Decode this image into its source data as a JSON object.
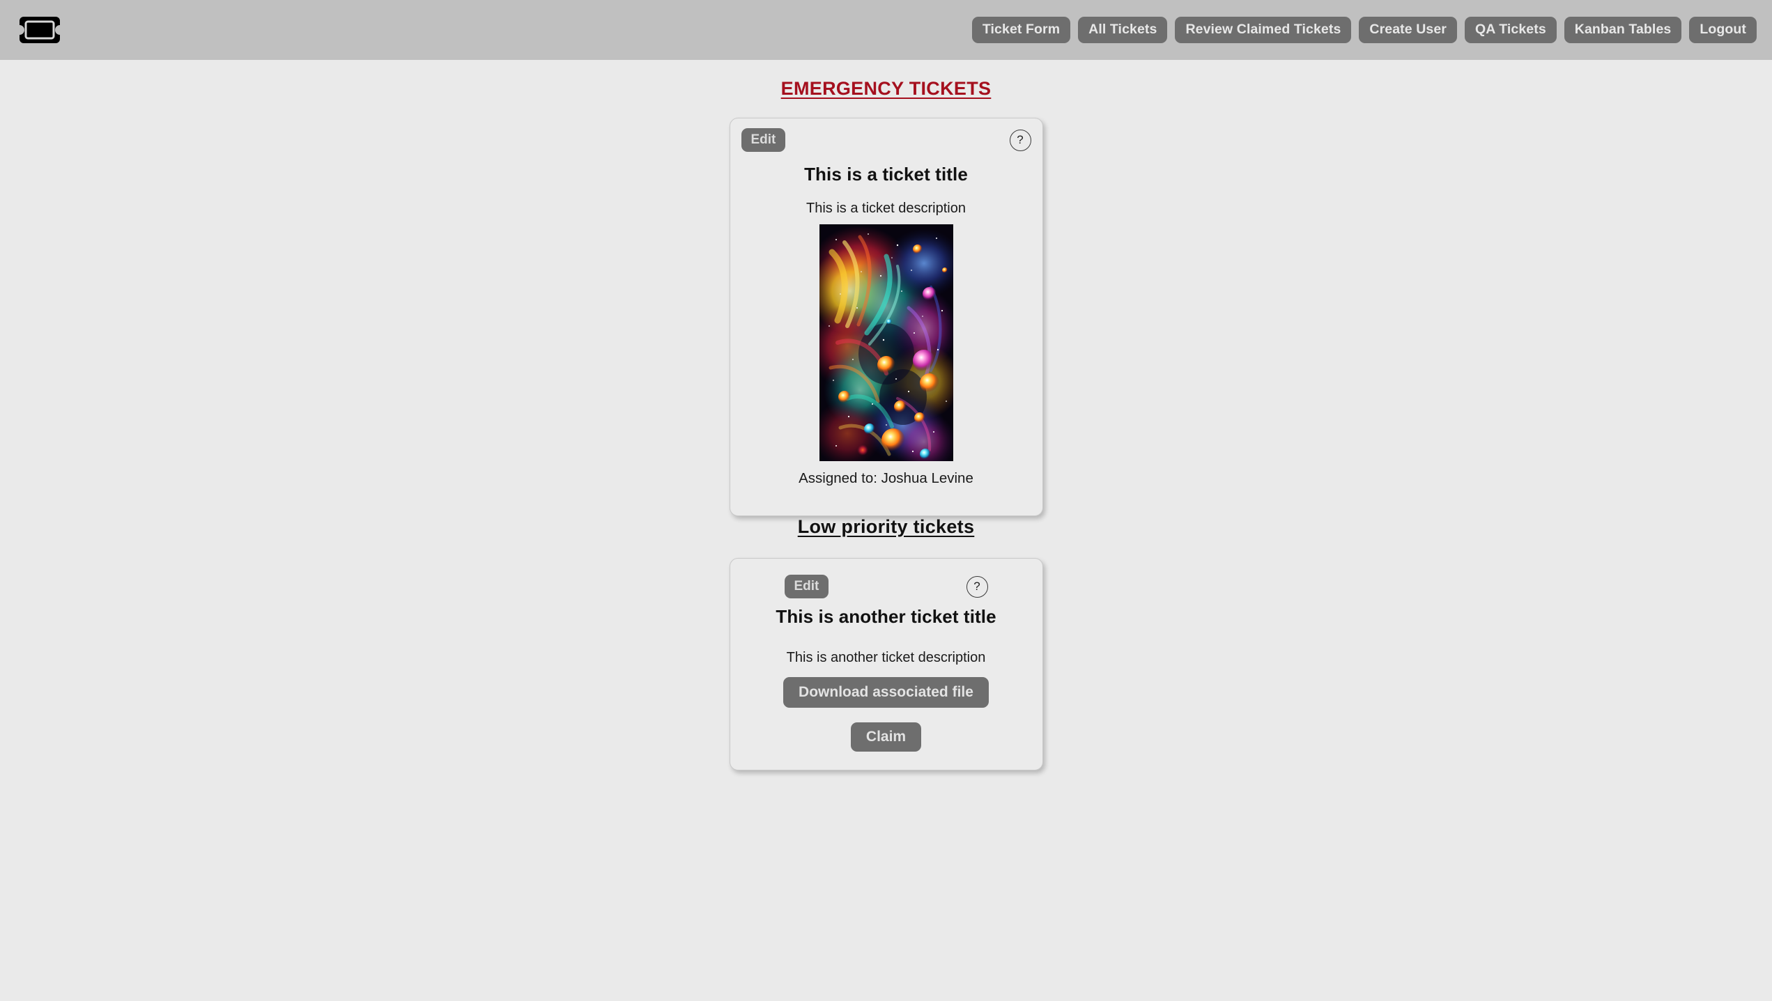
{
  "navbar": {
    "logo_icon": "ticket-icon",
    "links": [
      {
        "label": "Ticket Form"
      },
      {
        "label": "All Tickets"
      },
      {
        "label": "Review Claimed Tickets"
      },
      {
        "label": "Create User"
      },
      {
        "label": "QA Tickets"
      },
      {
        "label": "Kanban Tables"
      },
      {
        "label": "Logout"
      }
    ]
  },
  "colors": {
    "navbar_bg": "#c0c0c0",
    "page_bg": "#eaeaea",
    "emergency_heading": "#a5101e",
    "lowprio_heading": "#111111",
    "button_gray": "#6e6e6e",
    "card_bg": "#ebebeb"
  },
  "sections": {
    "emergency": {
      "heading": "EMERGENCY TICKETS",
      "card": {
        "edit_label": "Edit",
        "help_label": "?",
        "title": "This is a ticket title",
        "description": "This is a ticket description",
        "image_alt": "nebula-artwork",
        "assignee": "Assigned to: Joshua Levine"
      }
    },
    "low_priority": {
      "heading": "Low priority tickets",
      "card": {
        "edit_label": "Edit",
        "help_label": "?",
        "title": "This is another ticket title",
        "description": "This is another ticket description",
        "download_label": "Download associated file",
        "claim_label": "Claim"
      }
    }
  }
}
